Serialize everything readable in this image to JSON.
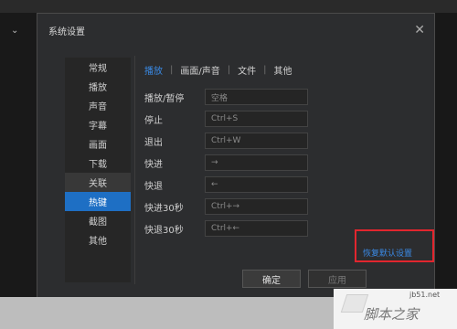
{
  "dialog": {
    "title": "系统设置",
    "close": "✕"
  },
  "nav": {
    "items": [
      {
        "label": "常规"
      },
      {
        "label": "播放"
      },
      {
        "label": "声音"
      },
      {
        "label": "字幕"
      },
      {
        "label": "画面"
      },
      {
        "label": "下载"
      },
      {
        "label": "关联"
      },
      {
        "label": "热键"
      },
      {
        "label": "截图"
      },
      {
        "label": "其他"
      }
    ],
    "active": "热键"
  },
  "tabs": [
    {
      "label": "播放"
    },
    {
      "label": "画面/声音"
    },
    {
      "label": "文件"
    },
    {
      "label": "其他"
    }
  ],
  "tab_separator": "|",
  "hotkeys": [
    {
      "label": "播放/暂停",
      "value": "空格"
    },
    {
      "label": "停止",
      "value": "Ctrl+S"
    },
    {
      "label": "退出",
      "value": "Ctrl+W"
    },
    {
      "label": "快进",
      "value": "→"
    },
    {
      "label": "快退",
      "value": "←"
    },
    {
      "label": "快进30秒",
      "value": "Ctrl+→"
    },
    {
      "label": "快退30秒",
      "value": "Ctrl+←"
    }
  ],
  "restore_link": "恢复默认设置",
  "buttons": {
    "ok": "确定",
    "apply": "应用"
  },
  "watermark": {
    "url": "jb51.net",
    "name": "脚本之家"
  },
  "colors": {
    "accent": "#1e6fc4",
    "link": "#3a8ae6",
    "highlight_box": "#e2262e",
    "dialog_bg": "#2c2d2f"
  }
}
